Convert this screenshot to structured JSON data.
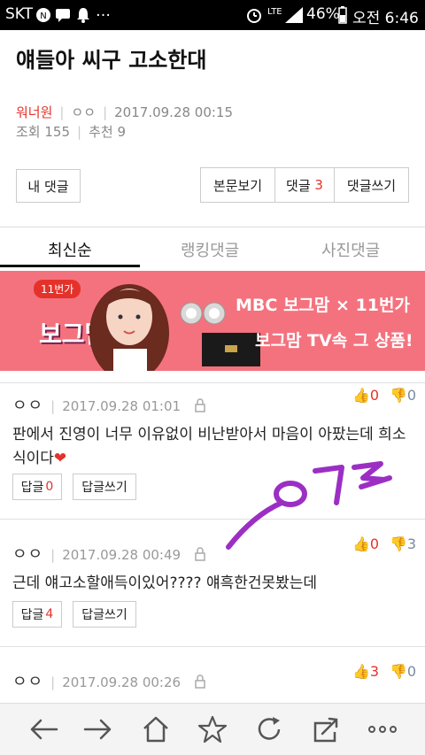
{
  "status_bar": {
    "carrier": "SKT",
    "network": "LTE",
    "battery": "46%",
    "time": "오전 6:46",
    "icons": [
      "message-icon",
      "bell-icon",
      "more-dots-icon",
      "alarm-icon",
      "signal-icon",
      "battery-icon"
    ]
  },
  "post": {
    "title": "얘들아 씨구 고소한대",
    "author": "워너원",
    "nickname": "ㅇㅇ",
    "date": "2017.09.28 00:15",
    "views_label": "조회",
    "views": "155",
    "recommend_label": "추천",
    "recommend": "9"
  },
  "actions": {
    "my_comments": "내 댓글",
    "view_body": "본문보기",
    "comments_label": "댓글",
    "comments_count": "3",
    "write_comment": "댓글쓰기"
  },
  "tabs": [
    {
      "label": "최신순",
      "active": true
    },
    {
      "label": "랭킹댓글",
      "active": false
    },
    {
      "label": "사진댓글",
      "active": false
    }
  ],
  "banner": {
    "badge": "11번가",
    "logo": "보그맘",
    "brand": "MBC 보그맘 × 11번가",
    "tagline": "보그맘 TV속 그 상품!"
  },
  "comments": [
    {
      "nickname": "ㅇㅇ",
      "date": "2017.09.28 01:01",
      "up": "0",
      "down": "0",
      "text": "판에서 진영이 너무 이유없이 비난받아서 마음이 아팠는데 희소식이다",
      "reply_label": "답글",
      "reply_count": "0",
      "write_reply": "답글쓰기"
    },
    {
      "nickname": "ㅇㅇ",
      "date": "2017.09.28 00:49",
      "up": "0",
      "down": "3",
      "text": "근데 얘고소할애득이있어???? 얘흑한건못봤는데",
      "reply_label": "답글",
      "reply_count": "4",
      "write_reply": "답글쓰기"
    },
    {
      "nickname": "ㅇㅇ",
      "date": "2017.09.28 00:26",
      "up": "3",
      "down": "0"
    }
  ],
  "handwriting": "ㅇㄱㄹ",
  "colors": {
    "accent": "#e4322b",
    "banner_bg": "#f4727e",
    "scribble": "#9b2fc4"
  },
  "bottom_nav": [
    "back-icon",
    "forward-icon",
    "home-icon",
    "bookmark-star-icon",
    "refresh-icon",
    "share-icon",
    "more-icon"
  ]
}
